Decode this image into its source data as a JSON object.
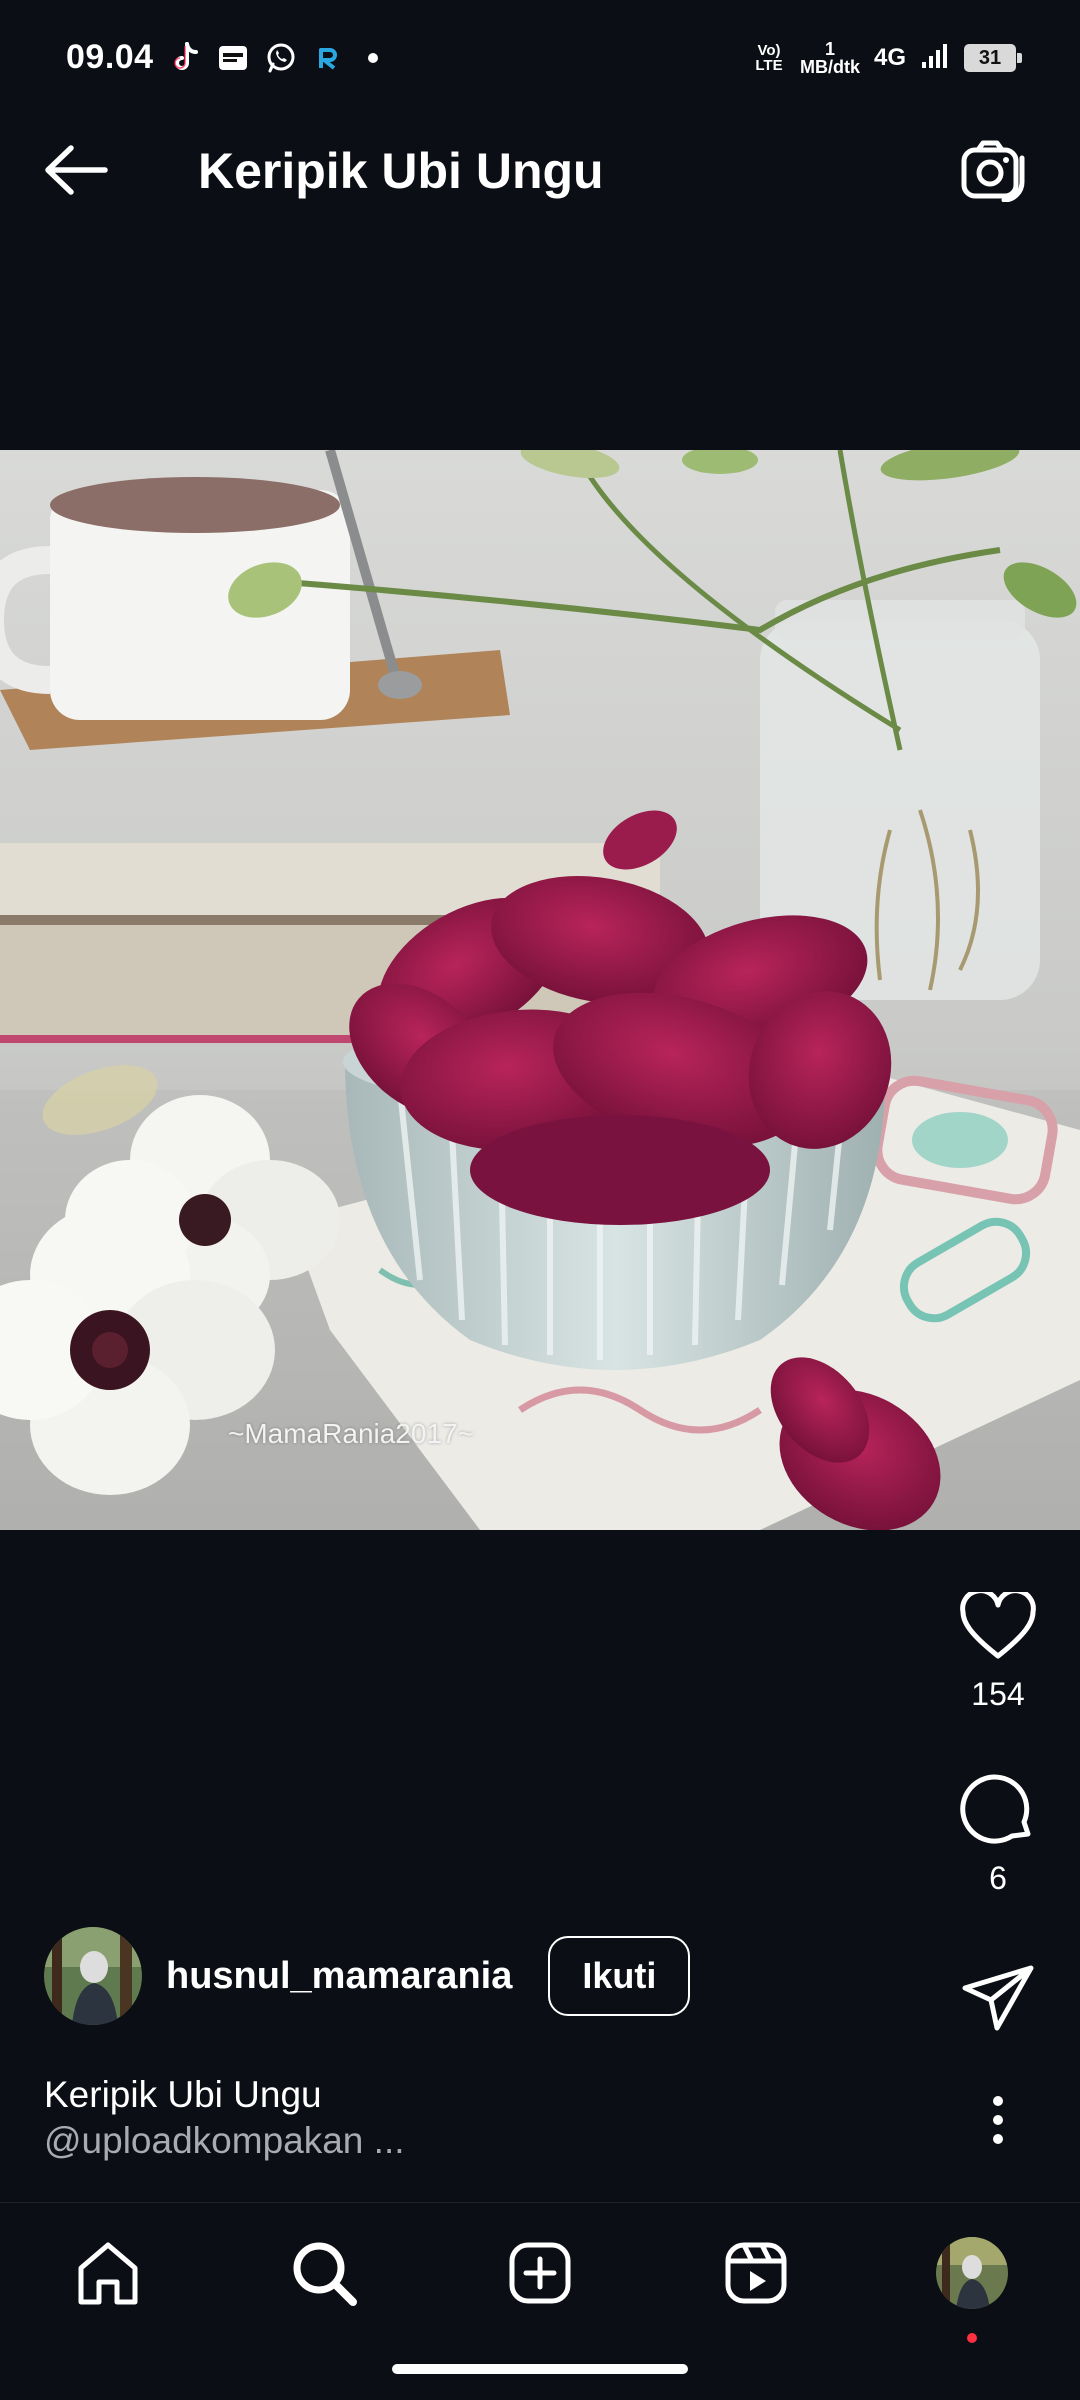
{
  "status_bar": {
    "time": "09.04",
    "notification_icons": [
      "tiktok-icon",
      "samsung-news-icon",
      "whatsapp-icon",
      "app-r-icon"
    ],
    "volte_label": "Vo) LTE",
    "speed_value": "1",
    "speed_unit": "MB/dtk",
    "network": "4G",
    "battery": "31"
  },
  "header": {
    "title": "Keripik Ubi Ungu",
    "back_icon": "arrow-left-icon",
    "camera_icon": "camera-icon"
  },
  "post": {
    "watermark": "~MamaRania2017~",
    "likes": "154",
    "comments": "6"
  },
  "author": {
    "username": "husnul_mamarania",
    "follow_label": "Ikuti"
  },
  "caption": {
    "title": "Keripik Ubi Ungu",
    "mention": "@uploadkompakan ..."
  },
  "nav": {
    "items": [
      "home-icon",
      "search-icon",
      "add-post-icon",
      "reels-icon",
      "profile-avatar"
    ]
  },
  "colors": {
    "background": "#0b0e14",
    "text": "#ffffff",
    "secondary_text": "#a8abb3",
    "notification_dot": "#ff3040"
  }
}
